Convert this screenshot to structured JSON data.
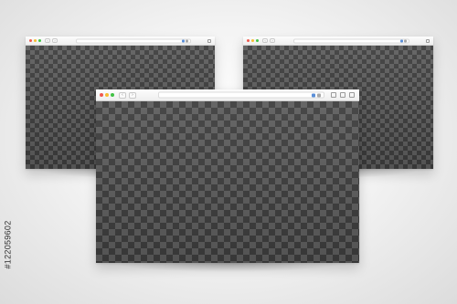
{
  "windows": [
    {
      "id": "left",
      "nav": [
        "‹",
        "›"
      ],
      "address_icons": [
        "blue-square-icon",
        "grey-square-icon"
      ],
      "tools": [
        "square-outline-icon"
      ]
    },
    {
      "id": "right",
      "nav": [
        "‹",
        "›"
      ],
      "address_icons": [
        "blue-square-icon",
        "grey-square-icon"
      ],
      "tools": [
        "square-outline-icon"
      ]
    },
    {
      "id": "front",
      "nav": [
        "‹",
        "›"
      ],
      "address_icons": [
        "blue-square-icon",
        "grey-square-icon"
      ],
      "tools": [
        "settings-icon",
        "share-icon",
        "window-icon"
      ]
    }
  ],
  "colors": {
    "background": "#ececec",
    "checker_dark": "#3d3d3d",
    "checker_light": "#5d5d5d",
    "traffic_close": "#ef5a4f",
    "traffic_minimize": "#f7bd32",
    "traffic_maximize": "#41c246",
    "address_accent": "#5a8fd8"
  },
  "stock_code": "#122059602"
}
